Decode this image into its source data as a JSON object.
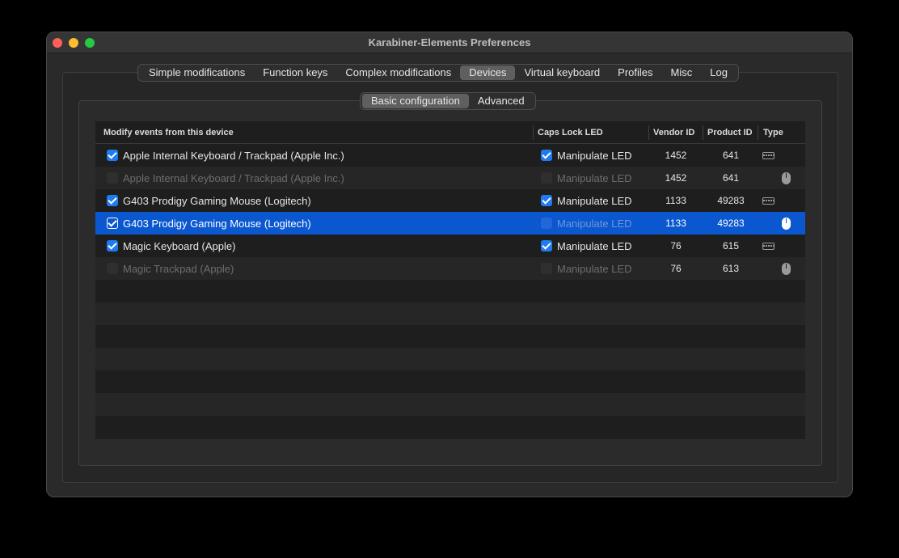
{
  "window": {
    "title": "Karabiner-Elements Preferences"
  },
  "tabs": [
    "Simple modifications",
    "Function keys",
    "Complex modifications",
    "Devices",
    "Virtual keyboard",
    "Profiles",
    "Misc",
    "Log"
  ],
  "active_tab": "Devices",
  "subtabs": [
    "Basic configuration",
    "Advanced"
  ],
  "active_subtab": "Basic configuration",
  "table": {
    "headers": {
      "device": "Modify events from this device",
      "caps": "Caps Lock LED",
      "vendor": "Vendor ID",
      "product": "Product ID",
      "type": "Type"
    },
    "rows": [
      {
        "name": "Apple Internal Keyboard / Trackpad (Apple Inc.)",
        "modify": true,
        "led_label": "Manipulate LED",
        "led": true,
        "vendor": "1452",
        "product": "641",
        "type": "keyboard-icon",
        "state": "enabled"
      },
      {
        "name": "Apple Internal Keyboard / Trackpad (Apple Inc.)",
        "modify": false,
        "led_label": "Manipulate LED",
        "led": false,
        "vendor": "1452",
        "product": "641",
        "type": "mouse-icon",
        "state": "disabled"
      },
      {
        "name": "G403 Prodigy Gaming Mouse (Logitech)",
        "modify": true,
        "led_label": "Manipulate LED",
        "led": true,
        "vendor": "1133",
        "product": "49283",
        "type": "keyboard-icon",
        "state": "enabled"
      },
      {
        "name": "G403 Prodigy Gaming Mouse (Logitech)",
        "modify": true,
        "led_label": "Manipulate LED",
        "led": false,
        "vendor": "1133",
        "product": "49283",
        "type": "mouse-icon",
        "state": "selected"
      },
      {
        "name": "Magic Keyboard (Apple)",
        "modify": true,
        "led_label": "Manipulate LED",
        "led": true,
        "vendor": "76",
        "product": "615",
        "type": "keyboard-icon",
        "state": "enabled"
      },
      {
        "name": "Magic Trackpad (Apple)",
        "modify": false,
        "led_label": "Manipulate LED",
        "led": false,
        "vendor": "76",
        "product": "613",
        "type": "mouse-icon",
        "state": "disabled"
      }
    ]
  },
  "colors": {
    "selection": "#0a57d0",
    "checkbox": "#1f7bf2"
  }
}
